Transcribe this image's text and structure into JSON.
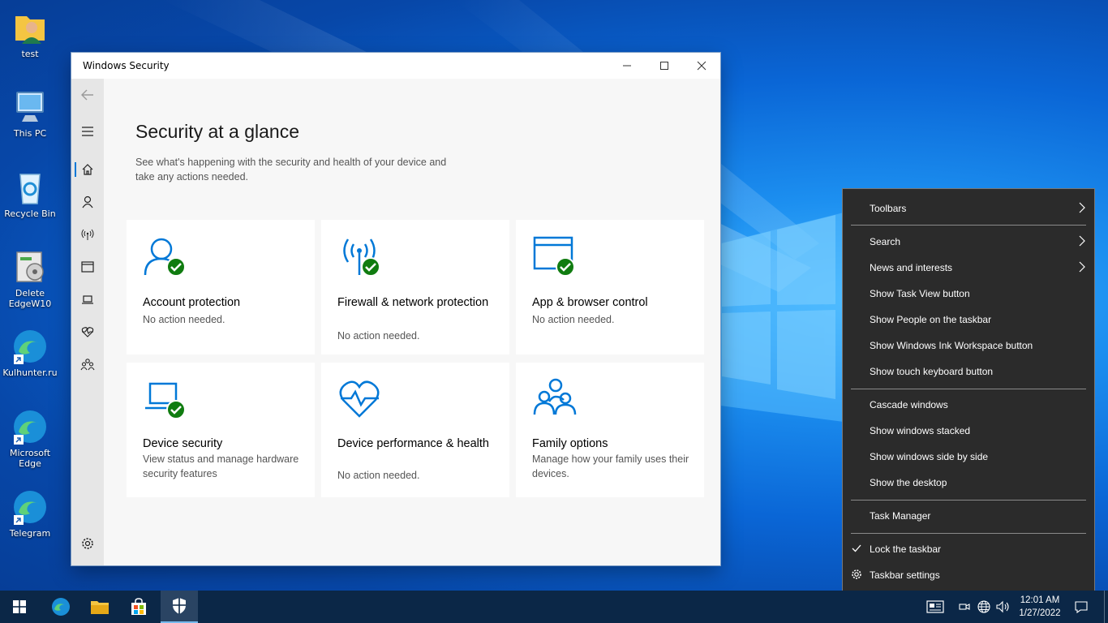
{
  "desktop": {
    "icons": [
      {
        "label": "test"
      },
      {
        "label": "This PC"
      },
      {
        "label": "Recycle Bin"
      },
      {
        "label": "Delete EdgeW10"
      },
      {
        "label": "Kulhunter.ru"
      },
      {
        "label": "Microsoft Edge"
      },
      {
        "label": "Telegram"
      }
    ]
  },
  "window": {
    "title": "Windows Security",
    "page_title": "Security at a glance",
    "subtitle": "See what's happening with the security and health of your device and take any actions needed.",
    "tiles": [
      {
        "name": "Account protection",
        "status": "No action needed.",
        "icon": "account-icon"
      },
      {
        "name": "Firewall & network protection",
        "status": "No action needed.",
        "icon": "firewall-icon"
      },
      {
        "name": "App & browser control",
        "status": "No action needed.",
        "icon": "app-browser-icon"
      },
      {
        "name": "Device security",
        "status": "View status and manage hardware security features",
        "icon": "device-security-icon"
      },
      {
        "name": "Device performance & health",
        "status": "No action needed.",
        "icon": "heart-icon"
      },
      {
        "name": "Family options",
        "status": "Manage how your family uses their devices.",
        "icon": "family-icon"
      }
    ],
    "accent": "#0078d7",
    "ok_color": "#107c10"
  },
  "context_menu": {
    "items": [
      {
        "label": "Toolbars"
      },
      {
        "label": "Search"
      },
      {
        "label": "News and interests"
      },
      {
        "label": "Show Task View button"
      },
      {
        "label": "Show People on the taskbar"
      },
      {
        "label": "Show Windows Ink Workspace button"
      },
      {
        "label": "Show touch keyboard button"
      },
      {
        "label": "Cascade windows"
      },
      {
        "label": "Show windows stacked"
      },
      {
        "label": "Show windows side by side"
      },
      {
        "label": "Show the desktop"
      },
      {
        "label": "Task Manager"
      },
      {
        "label": "Lock the taskbar"
      },
      {
        "label": "Taskbar settings"
      }
    ]
  },
  "taskbar": {
    "time": "12:01 AM",
    "date": "1/27/2022"
  }
}
